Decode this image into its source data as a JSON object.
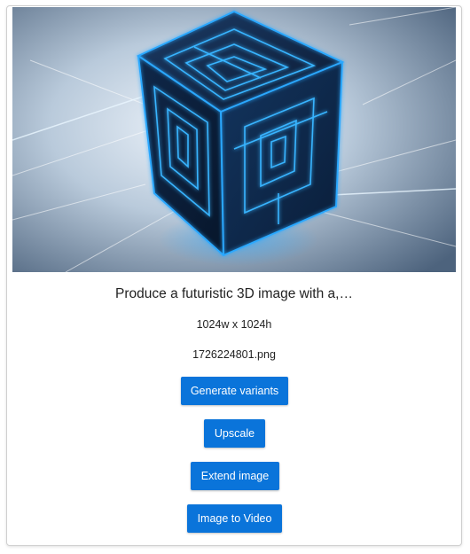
{
  "card": {
    "image_description_alt": "",
    "prompt": "Produce a futuristic 3D image with a,…",
    "dimensions": "1024w x 1024h",
    "filename": "1726224801.png"
  },
  "actions": {
    "generate_variants": "Generate variants",
    "upscale": "Upscale",
    "extend_image": "Extend image",
    "image_to_video": "Image to Video"
  },
  "colors": {
    "button_blue": "#0a74da",
    "glow_blue": "#2aa8ff"
  }
}
